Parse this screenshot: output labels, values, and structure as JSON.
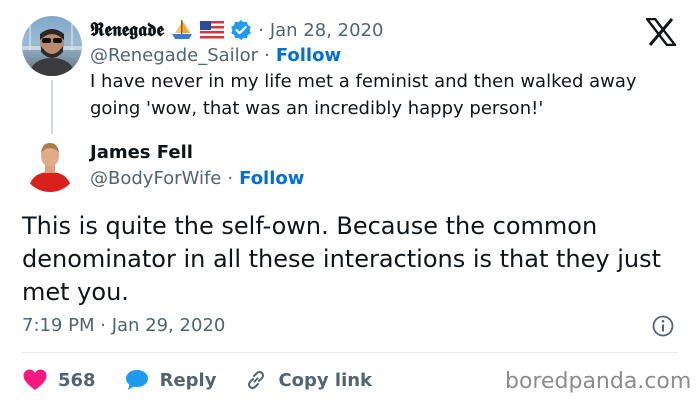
{
  "original_tweet": {
    "display_name": "𝕽𝖊𝖓𝖊𝖌𝖆𝖉𝖊",
    "handle": "@Renegade_Sailor",
    "follow_label": "Follow",
    "date": "Jan 28, 2020",
    "text": "I have never in my life met a feminist and then walked away going 'wow, that was an incredibly happy person!'"
  },
  "reply_tweet": {
    "display_name": "James Fell",
    "handle": "@BodyForWife",
    "follow_label": "Follow",
    "text": "This is quite the self-own. Because the common denominator in all these interactions is that they just met you.",
    "time": "7:19 PM",
    "date": "Jan 29, 2020"
  },
  "actions": {
    "likes": "568",
    "reply_label": "Reply",
    "copy_link_label": "Copy link"
  },
  "watermark": "boredpanda.com",
  "icons": [
    "x-logo-icon",
    "sailboat-icon",
    "us-flag-icon",
    "verified-badge-icon",
    "info-icon",
    "heart-icon",
    "reply-bubble-icon",
    "link-icon"
  ],
  "colors": {
    "verified": "#1d9bf0",
    "follow": "#006fd6",
    "heart": "#f91880",
    "reply": "#1d9bf0",
    "muted": "#536471"
  }
}
